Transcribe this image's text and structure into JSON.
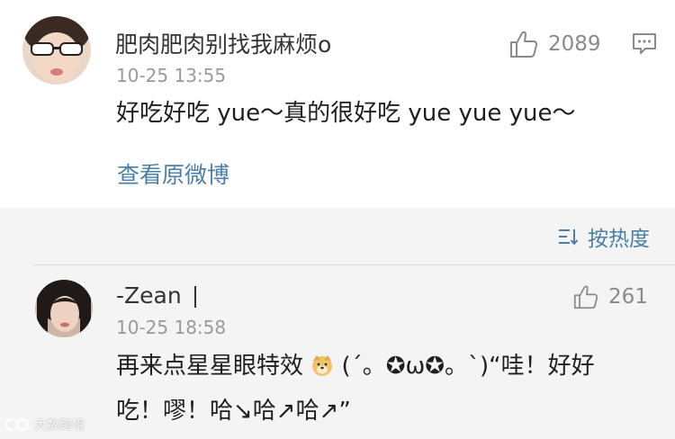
{
  "top_comment": {
    "username": "肥肉肥肉别找我麻烦o",
    "timestamp": "10-25 13:55",
    "text": "好吃好吃 yue～真的很好吃 yue yue yue～",
    "like_count": "2089",
    "view_original_label": "查看原微博"
  },
  "sort": {
    "label": "按热度"
  },
  "reply": {
    "username": "-Zean",
    "timestamp": "10-25 18:58",
    "text_line1_before": "再来点星星眼特效",
    "text_line1_after": "(´。✪ω✪。`)“哇！好好",
    "text_line2": "吃！嘐！哈↘哈↗哈↗”",
    "like_count": "261"
  },
  "watermark": {
    "text": "大数跨境"
  },
  "colors": {
    "link_blue": "#4a7fa8",
    "page_bg": "#f4f4f4",
    "card_bg": "#ffffff",
    "muted_gray": "#9a9a9a"
  }
}
